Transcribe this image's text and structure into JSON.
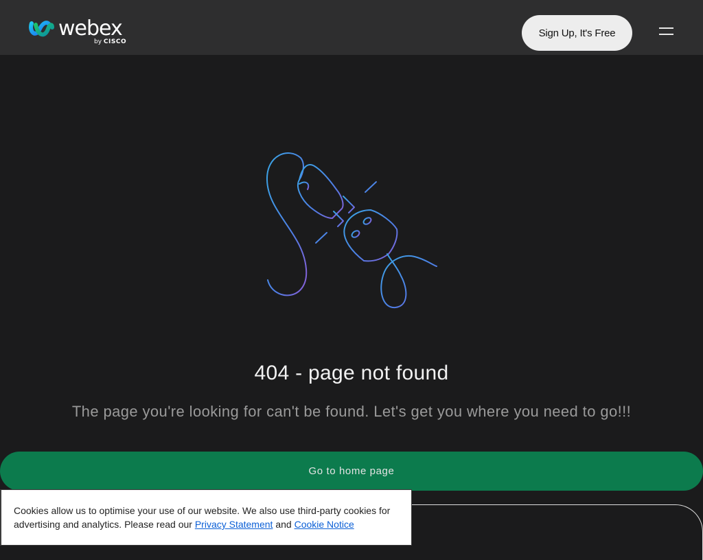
{
  "header": {
    "logo_text": "webex",
    "logo_by": "by",
    "logo_brand": "CISCO",
    "signup_label": "Sign Up, It's Free",
    "menu_icon": "hamburger-menu-icon"
  },
  "main": {
    "illustration_icon": "unplugged-cable-icon",
    "title": "404 - page not found",
    "subtitle": "The page you're looking for can't be found. Let's get you where you need to go!!!",
    "home_button_label": "Go to home page"
  },
  "cookie_banner": {
    "text_part1": "Cookies allow us to optimise your use of our website. We also use third-party cookies for advertising and analytics. Please read our ",
    "privacy_link": "Privacy Statement",
    "and_text": " and ",
    "cookie_link": "Cookie Notice"
  },
  "colors": {
    "header_bg": "#2e2e2f",
    "page_bg": "#1b1b1c",
    "home_button": "#0c7b4d",
    "link": "#0b5fd6"
  }
}
